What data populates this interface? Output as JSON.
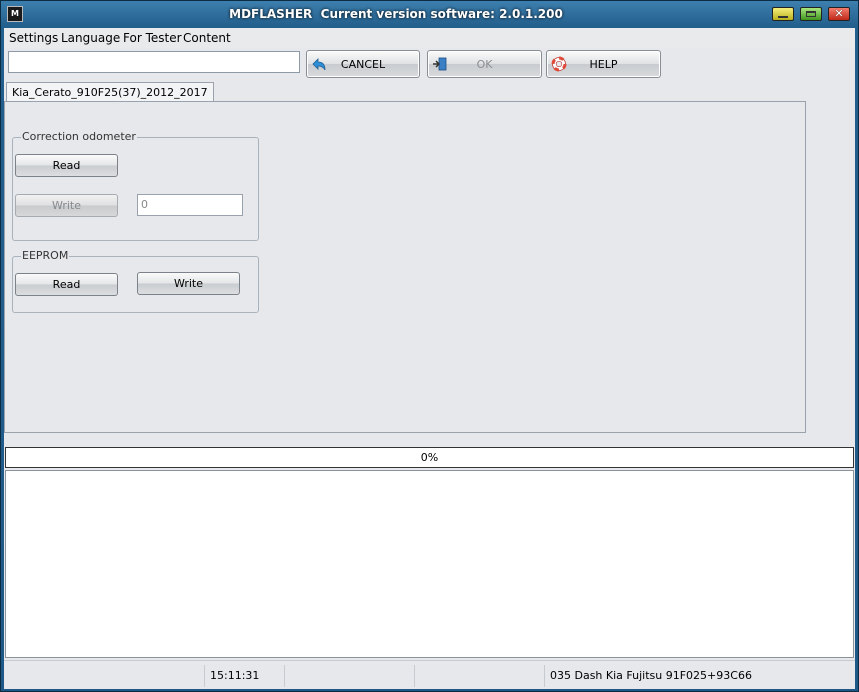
{
  "window": {
    "title": "MDFLASHER  Current version software: 2.0.1.200",
    "controls": {
      "minimize_icon": "minimize-icon",
      "maximize_icon": "maximize-icon",
      "close_glyph": "✕"
    }
  },
  "menu": {
    "items": [
      "Settings",
      "Language",
      "For Tester",
      "Content"
    ]
  },
  "toolbar": {
    "input_value": "",
    "cancel_label": "CANCEL",
    "ok_label": "OK",
    "help_label": "HELP"
  },
  "tab": {
    "label": "Kia_Cerato_910F25(37)_2012_2017"
  },
  "odometer": {
    "title": "Correction odometer",
    "read_label": "Read",
    "write_label": "Write",
    "value": "0"
  },
  "eeprom": {
    "title": "EEPROM",
    "read_label": "Read",
    "write_label": "Write"
  },
  "progress": {
    "text": "0%",
    "value": 0
  },
  "status": {
    "time": "15:11:31",
    "device": "035 Dash Kia Fujitsu 91F025+93C66"
  },
  "colors": {
    "titlebar": "#235f8d",
    "client_bg": "#e6e8eb"
  }
}
